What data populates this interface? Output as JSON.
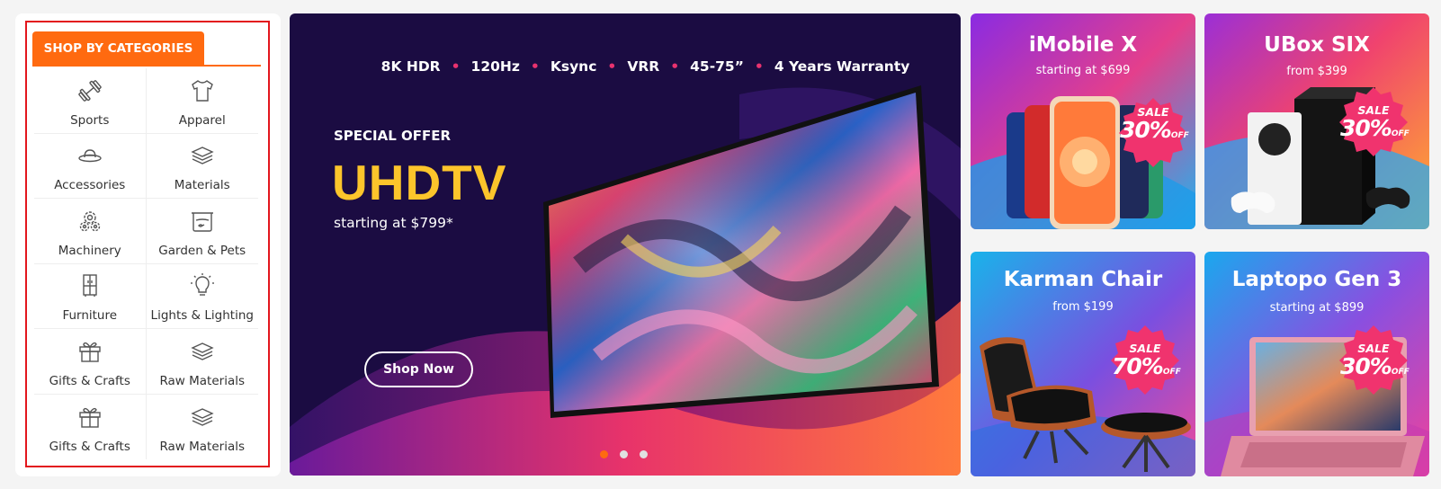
{
  "categories": {
    "heading": "SHOP BY CATEGORIES",
    "items": [
      {
        "label": "Sports",
        "icon": "dumbbell-icon"
      },
      {
        "label": "Apparel",
        "icon": "tshirt-icon"
      },
      {
        "label": "Accessories",
        "icon": "hat-icon"
      },
      {
        "label": "Materials",
        "icon": "layers-icon"
      },
      {
        "label": "Machinery",
        "icon": "gears-icon"
      },
      {
        "label": "Garden & Pets",
        "icon": "aquarium-icon"
      },
      {
        "label": "Furniture",
        "icon": "cabinet-icon"
      },
      {
        "label": "Lights & Lighting",
        "icon": "lightbulb-icon"
      },
      {
        "label": "Gifts & Crafts",
        "icon": "gift-icon"
      },
      {
        "label": "Raw Materials",
        "icon": "layers-icon"
      },
      {
        "label": "Gifts & Crafts",
        "icon": "gift-icon"
      },
      {
        "label": "Raw Materials",
        "icon": "layers-icon"
      }
    ]
  },
  "hero": {
    "specs": [
      "8K HDR",
      "120Hz",
      "Ksync",
      "VRR",
      "45-75”",
      "4 Years Warranty"
    ],
    "eyebrow": "SPECIAL OFFER",
    "title": "UHDTV",
    "subtitle": "starting at $799*",
    "cta_label": "Shop Now",
    "slides": 3,
    "active_slide": 1
  },
  "promos": [
    {
      "title": "iMobile X",
      "subtitle": "starting at $699",
      "sale_label": "SALE",
      "sale_pct": "30%",
      "sale_suffix": "OFF"
    },
    {
      "title": "UBox SIX",
      "subtitle": "from $399",
      "sale_label": "SALE",
      "sale_pct": "30%",
      "sale_suffix": "OFF"
    },
    {
      "title": "Karman Chair",
      "subtitle": "from $199",
      "sale_label": "SALE",
      "sale_pct": "70%",
      "sale_suffix": "OFF"
    },
    {
      "title": "Laptopo Gen 3",
      "subtitle": "starting at $899",
      "sale_label": "SALE",
      "sale_pct": "30%",
      "sale_suffix": "OFF"
    }
  ],
  "colors": {
    "accent": "#ff6a10",
    "highlight_outline": "#e3161d",
    "hero_bg": "#1b0c42",
    "hero_title": "#fcc52b",
    "sale_badge": "#f0336e"
  }
}
